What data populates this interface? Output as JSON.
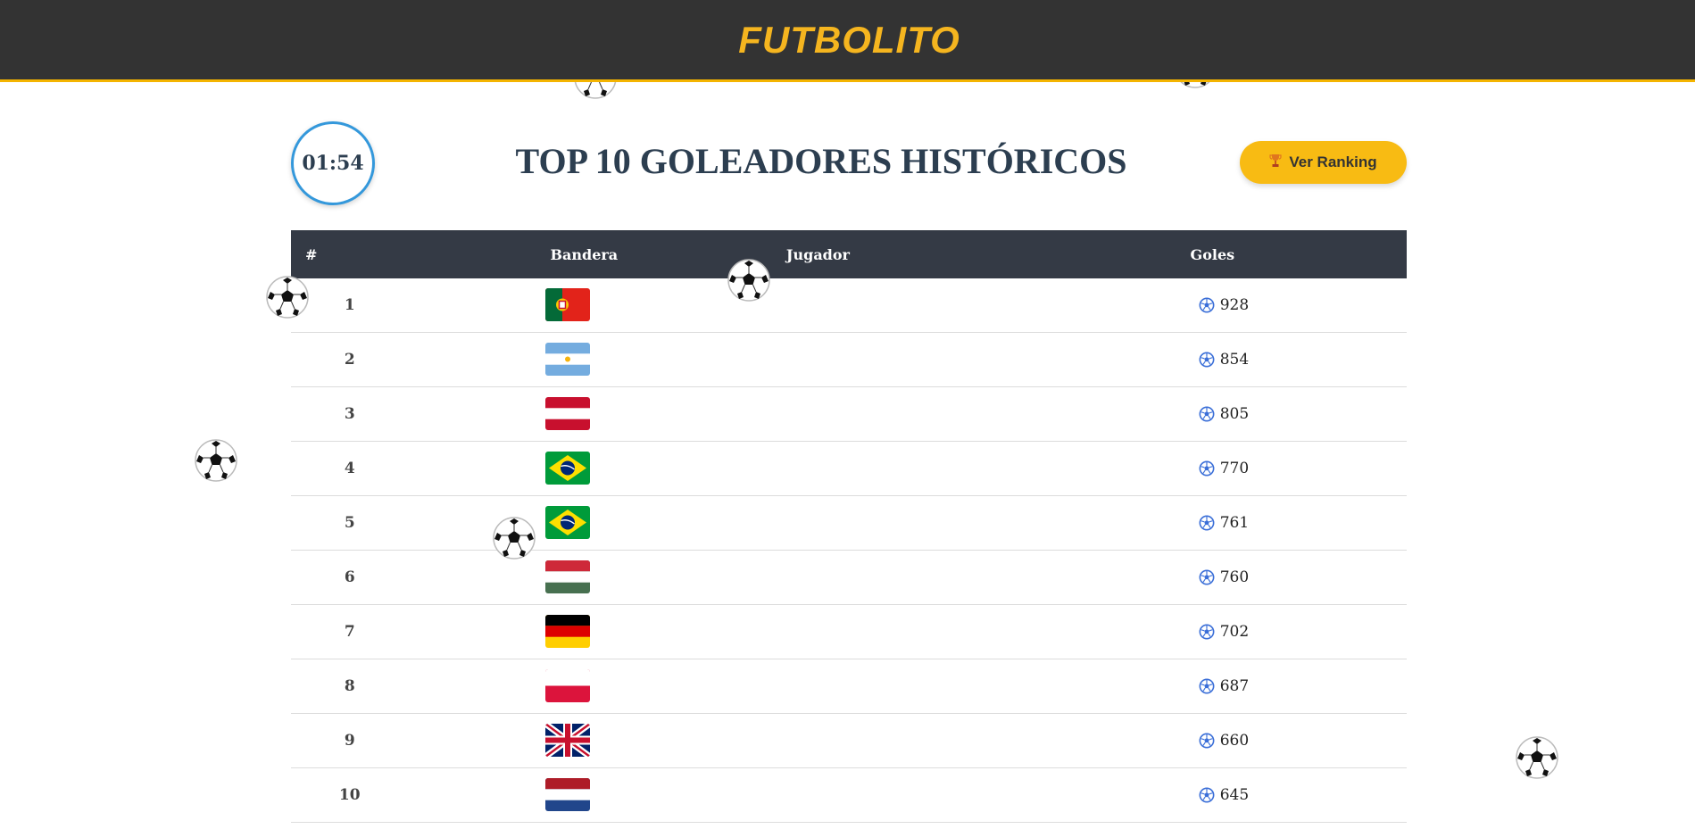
{
  "header": {
    "brand": "FUTBOLITO"
  },
  "timer": {
    "value": "01:54"
  },
  "page": {
    "title": "TOP 10 GOLEADORES HISTÓRICOS"
  },
  "ranking_button": {
    "label": "Ver Ranking",
    "icon": "trophy-icon"
  },
  "table": {
    "columns": [
      "#",
      "Bandera",
      "Jugador",
      "Goles"
    ],
    "rows": [
      {
        "rank": "1",
        "flag": "portugal",
        "player": "",
        "goals": "928"
      },
      {
        "rank": "2",
        "flag": "argentina",
        "player": "",
        "goals": "854"
      },
      {
        "rank": "3",
        "flag": "austria",
        "player": "",
        "goals": "805"
      },
      {
        "rank": "4",
        "flag": "brazil",
        "player": "",
        "goals": "770"
      },
      {
        "rank": "5",
        "flag": "brazil",
        "player": "",
        "goals": "761"
      },
      {
        "rank": "6",
        "flag": "hungary",
        "player": "",
        "goals": "760"
      },
      {
        "rank": "7",
        "flag": "germany",
        "player": "",
        "goals": "702"
      },
      {
        "rank": "8",
        "flag": "poland",
        "player": "",
        "goals": "687"
      },
      {
        "rank": "9",
        "flag": "united-kingdom",
        "player": "",
        "goals": "660"
      },
      {
        "rank": "10",
        "flag": "netherlands",
        "player": "",
        "goals": "645"
      }
    ]
  },
  "colors": {
    "header_bg": "#333333",
    "brand": "#f5b51f",
    "accent_line": "#f4b400",
    "timer_border": "#3498db",
    "button_bg": "#f8bb13",
    "table_header_bg": "#343a45",
    "title": "#2c3e50"
  }
}
